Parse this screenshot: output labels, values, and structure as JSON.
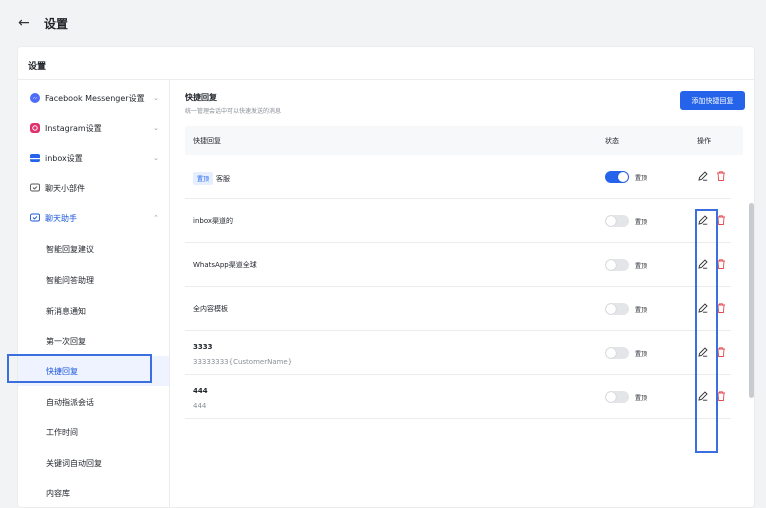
{
  "header": {
    "title": "设置"
  },
  "card": {
    "title": "设置"
  },
  "sidebar": {
    "items": [
      {
        "label": "Facebook Messenger设置"
      },
      {
        "label": "Instagram设置"
      },
      {
        "label": "inbox设置"
      },
      {
        "label": "聊天小部件"
      },
      {
        "label": "聊天助手"
      }
    ],
    "sub_items": [
      {
        "label": "智能回复建议"
      },
      {
        "label": "智能问答助理"
      },
      {
        "label": "新消息通知"
      },
      {
        "label": "第一次回复"
      },
      {
        "label": "快捷回复"
      },
      {
        "label": "自动指派会话"
      },
      {
        "label": "工作时间"
      },
      {
        "label": "关键词自动回复"
      },
      {
        "label": "内容库"
      }
    ]
  },
  "main": {
    "title": "快捷回复",
    "subtitle": "统一管理会话中可以快速发送的消息",
    "add_button": "添加快捷回复",
    "columns": {
      "name": "快捷回复",
      "status": "状态",
      "actions": "操作"
    },
    "pin_label": "置顶",
    "rows": [
      {
        "tag": "置顶",
        "name": "客服",
        "sub": "",
        "on": true
      },
      {
        "tag": "",
        "name": "inbox渠道的",
        "sub": "",
        "on": false
      },
      {
        "tag": "",
        "name": "WhatsApp渠道全球",
        "sub": "",
        "on": false
      },
      {
        "tag": "",
        "name": "全内容模板",
        "sub": "",
        "on": false
      },
      {
        "tag": "",
        "name": "3333",
        "sub": "33333333{CustomerName}",
        "on": false
      },
      {
        "tag": "",
        "name": "444",
        "sub": "444",
        "on": false
      }
    ]
  },
  "colors": {
    "accent": "#2563eb",
    "highlight": "#3b6fe0",
    "delete": "#e5484d"
  },
  "icons": [
    "back-arrow-icon",
    "messenger-icon",
    "instagram-icon",
    "inbox-icon",
    "chat-widget-icon",
    "chat-assistant-icon",
    "chevron-icon",
    "edit-icon",
    "delete-icon"
  ]
}
